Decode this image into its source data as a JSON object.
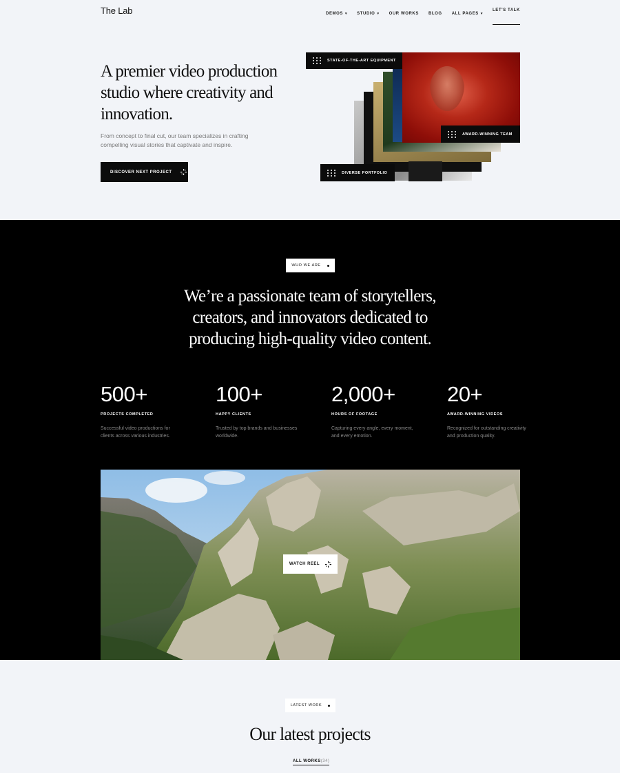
{
  "nav": {
    "logo": "The Lab",
    "items": [
      {
        "label": "DEMOS",
        "has_caret": true
      },
      {
        "label": "STUDIO",
        "has_caret": true
      },
      {
        "label": "OUR WORKS",
        "has_caret": false
      },
      {
        "label": "BLOG",
        "has_caret": false
      },
      {
        "label": "ALL PAGES",
        "has_caret": true
      }
    ],
    "cta": "LET'S TALK"
  },
  "hero": {
    "title": "A premier video production studio where creativity and innovation.",
    "description": "From concept to final cut, our team specializes in crafting compelling visual stories that captivate and inspire.",
    "button": "DISCOVER NEXT PROJECT",
    "tags": {
      "equipment": "STATE-OF-THE-ART EQUIPMENT",
      "award": "AWARD-WINNING TEAM",
      "portfolio": "DIVERSE PORTFOLIO"
    }
  },
  "about": {
    "pill": "WHO WE ARE",
    "title": "We’re a passionate team of storytellers, creators, and innovators dedicated to producing high-quality video content.",
    "stats": [
      {
        "number": "500+",
        "label": "PROJECTS COMPLETED",
        "desc": "Successful video productions for clients across various industries."
      },
      {
        "number": "100+",
        "label": "HAPPY CLIENTS",
        "desc": "Trusted by top brands and businesses worldwide."
      },
      {
        "number": "2,000+",
        "label": "HOURS OF FOOTAGE",
        "desc": "Capturing every angle, every moment, and every emotion."
      },
      {
        "number": "20+",
        "label": "AWARD-WINNING VIDEOS",
        "desc": "Recognized for outstanding creativity and production quality."
      }
    ],
    "watch_button": "WATCH REEL"
  },
  "latest": {
    "pill": "LATEST WORK",
    "title": "Our latest projects",
    "all_works": "ALL WORKS",
    "all_works_count": "(34)"
  },
  "colors": {
    "background": "#f2f4f8",
    "dark": "#000000",
    "accent_red": "#b52818"
  }
}
